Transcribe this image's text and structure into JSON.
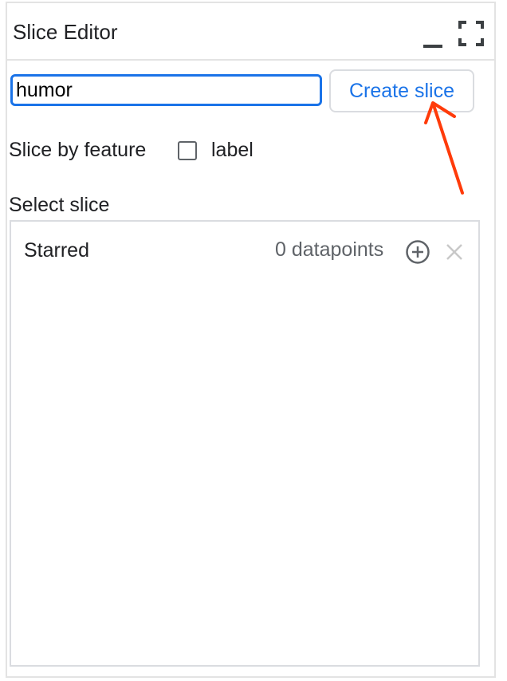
{
  "panel": {
    "title": "Slice Editor"
  },
  "slice_form": {
    "input_value": "humor",
    "create_button_label": "Create slice"
  },
  "features": {
    "label": "Slice by feature",
    "items": [
      {
        "label": "label",
        "checked": false
      }
    ]
  },
  "slice_select": {
    "label": "Select slice",
    "slices": [
      {
        "name": "Starred",
        "count_text": "0 datapoints"
      }
    ]
  },
  "colors": {
    "accent": "#1a73e8",
    "annotation_arrow": "#ff3b0a",
    "border": "#dadce0",
    "muted_text": "#5f6368"
  },
  "icons": {
    "minimize": "minimize-icon",
    "maximize": "fullscreen-icon",
    "add": "add-circle-icon",
    "remove": "close-icon",
    "annotation": "arrow-annotation"
  }
}
